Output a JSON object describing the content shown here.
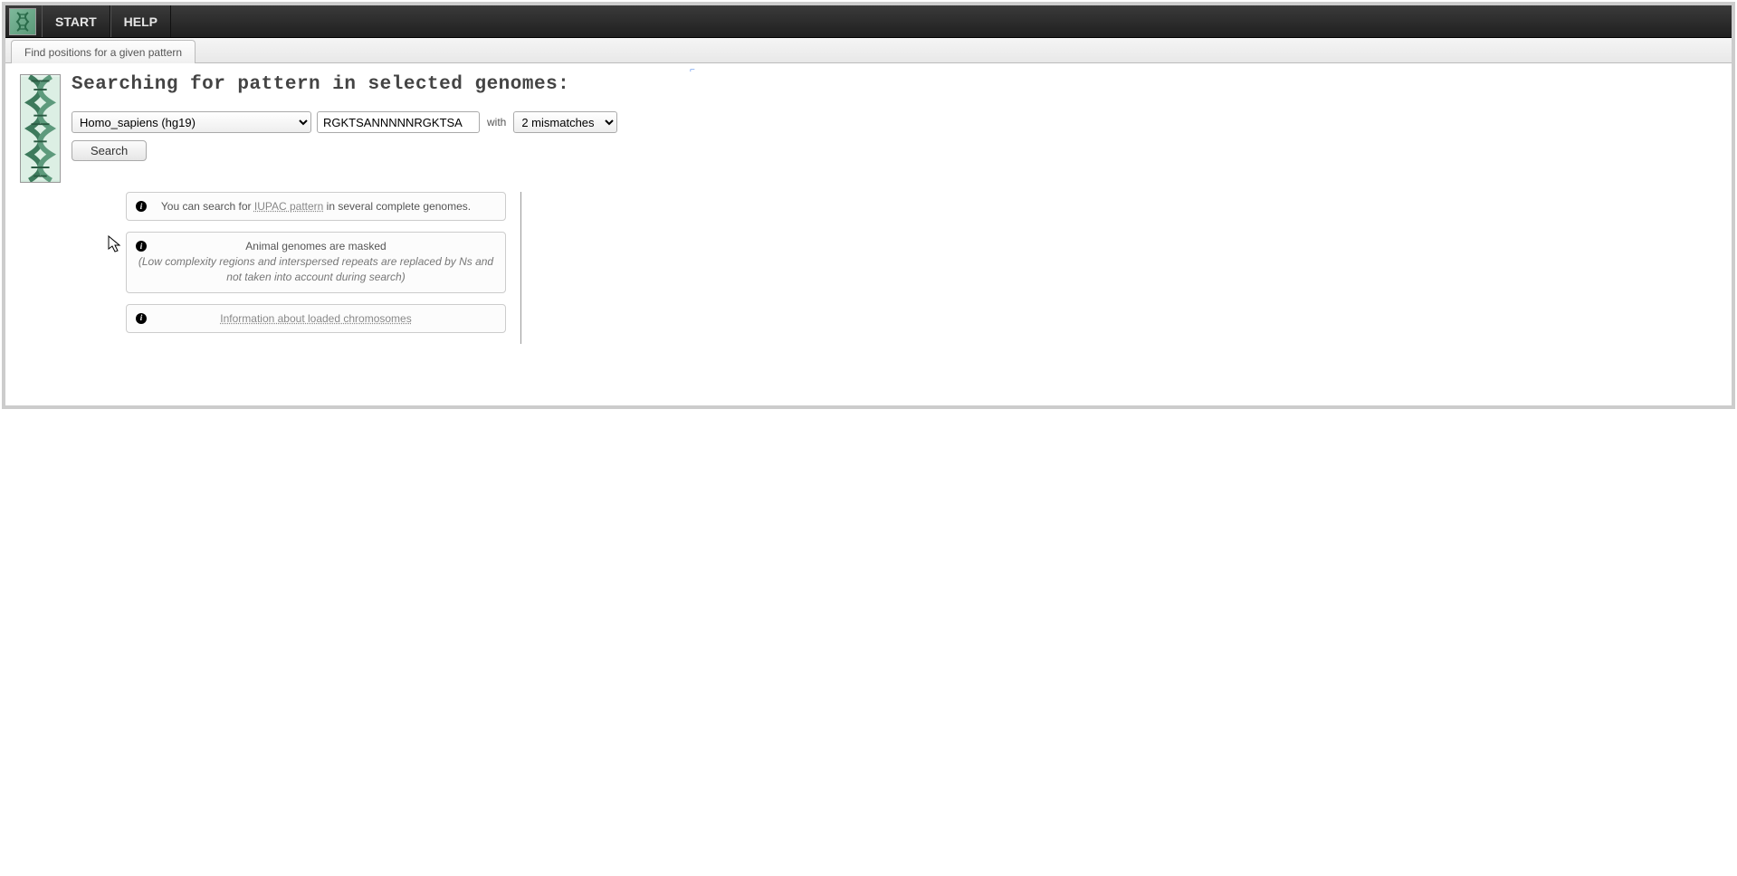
{
  "menu": {
    "start": "START",
    "help": "HELP"
  },
  "tab": {
    "label": "Find positions for a given pattern"
  },
  "page": {
    "title": "Searching for pattern in selected genomes:"
  },
  "form": {
    "genome_selected": "Homo_sapiens (hg19)",
    "pattern_value": "RGKTSANNNNNRGKTSA",
    "with_label": "with",
    "mismatch_selected": "2 mismatches",
    "search_label": "Search"
  },
  "info": {
    "card1_pre": "You can search for ",
    "card1_link": "IUPAC pattern",
    "card1_post": " in several complete genomes.",
    "card2_title": "Animal genomes are masked",
    "card2_note": "(Low complexity regions and interspersed repeats are replaced by Ns and not taken into account during search)",
    "card3_link": "Information about loaded chromosomes"
  }
}
